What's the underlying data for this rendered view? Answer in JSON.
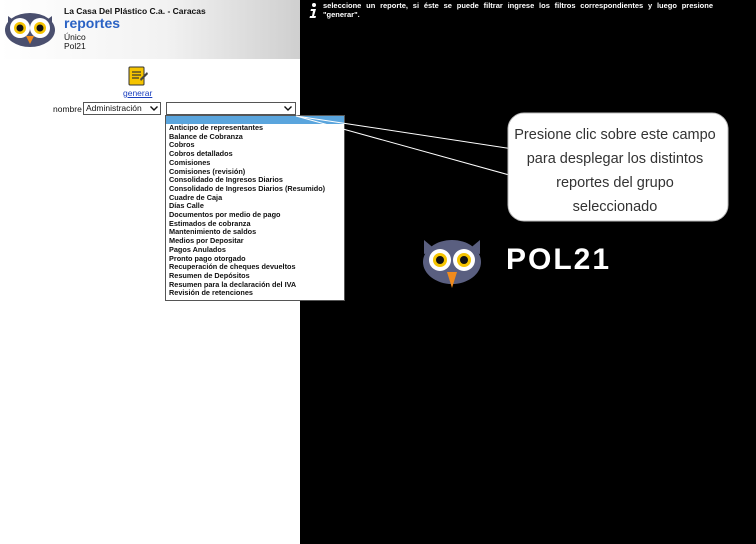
{
  "header": {
    "company": "La Casa Del Plástico C.a. - Caracas",
    "title": "reportes",
    "line1": "Único",
    "line2": "Pol21"
  },
  "toolbar": {
    "generate_label": "generar",
    "generate_icon": "report-generate-icon"
  },
  "filters": {
    "nombre_label": "nombre",
    "nombre_value": "Administración",
    "report_value": ""
  },
  "report_options": [
    "Anticipo de representantes",
    "Balance de Cobranza",
    "Cobros",
    "Cobros detallados",
    "Comisiones",
    "Comisiones (revisión)",
    "Consolidado de Ingresos Diarios",
    "Consolidado de Ingresos Diarios (Resumido)",
    "Cuadre de Caja",
    "Días Calle",
    "Documentos por medio de pago",
    "Estimados de cobranza",
    "Mantenimiento de saldos",
    "Medios por Depositar",
    "Pagos Anulados",
    "Pronto pago otorgado",
    "Recuperación de cheques devueltos",
    "Resumen de Depósitos",
    "Resumen para la declaración del IVA",
    "Revisión de retenciones"
  ],
  "info": {
    "icon": "info-icon",
    "text": "seleccione un reporte, si éste se puede filtrar ingrese los filtros correspondientes y luego presione \"generar\"."
  },
  "callout": {
    "text": "Presione clic sobre este campo para desplegar los distintos reportes del grupo seleccionado"
  },
  "brand": {
    "name": "POL21",
    "icon": "owl-logo-icon"
  },
  "colors": {
    "accent": "#2a62c4",
    "highlight": "#5aa5dd",
    "background": "#000000"
  }
}
